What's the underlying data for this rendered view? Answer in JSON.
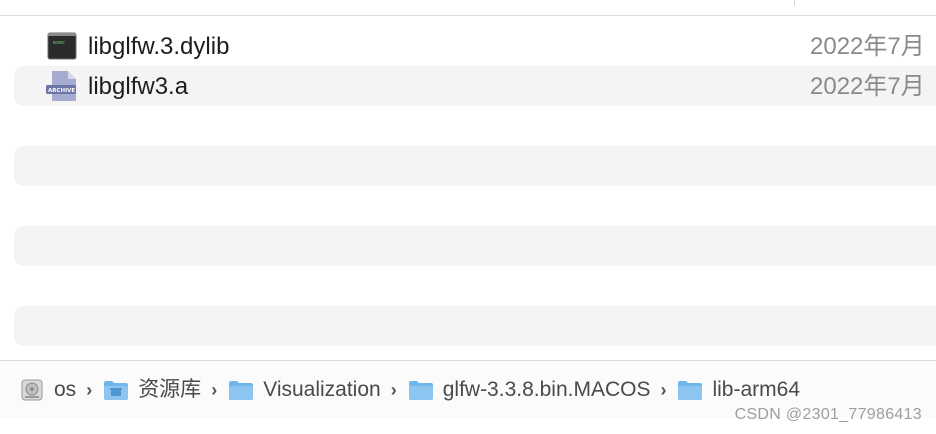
{
  "files": [
    {
      "name": "libglfw.3.dylib",
      "date": "2022年7月",
      "icon": "terminal-exec-icon",
      "icon_label": "exec"
    },
    {
      "name": "libglfw3.a",
      "date": "2022年7月",
      "icon": "archive-file-icon",
      "icon_label": "ARCHIVE"
    }
  ],
  "path_bar": {
    "items": [
      {
        "label": "os",
        "icon": "hard-disk-icon"
      },
      {
        "label": "资源库",
        "icon": "library-folder-icon"
      },
      {
        "label": "Visualization",
        "icon": "folder-icon"
      },
      {
        "label": "glfw-3.3.8.bin.MACOS",
        "icon": "folder-icon"
      },
      {
        "label": "lib-arm64",
        "icon": "folder-icon"
      }
    ],
    "separator": "›"
  },
  "watermark": "CSDN @2301_77986413",
  "colors": {
    "stripe": "#f4f4f4",
    "folder_blue": "#6fb6ea",
    "archive_purple": "#7d86b8"
  }
}
